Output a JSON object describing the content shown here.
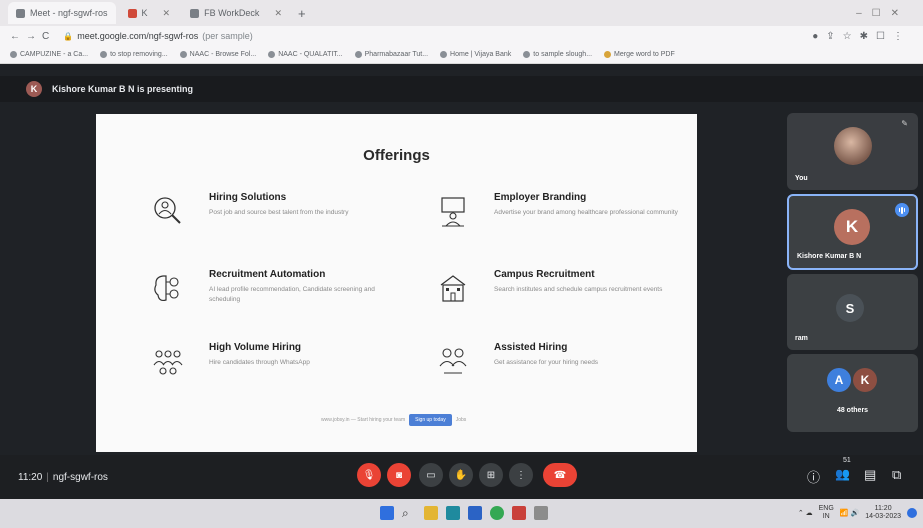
{
  "browser": {
    "tabs": [
      {
        "label": "Meet - ngf-sgwf-ros"
      },
      {
        "label": "K"
      },
      {
        "label": "FB WorkDeck"
      }
    ],
    "url": "meet.google.com/ngf-sgwf-ros",
    "url_suffix": "(per sample)",
    "bookmarks": [
      "CAMPUZINE - a Ca...",
      "to stop removing...",
      "NAAC - Browse Fol...",
      "NAAC - QUALATIT...",
      "Pharmabazaar Tut...",
      "Home | Vijaya Bank",
      "to sample slough...",
      "Merge word to PDF"
    ]
  },
  "banner": {
    "avatar_letter": "K",
    "text": "Kishore Kumar B N is presenting"
  },
  "slide": {
    "title": "Offerings",
    "offerings": [
      {
        "title": "Hiring Solutions",
        "desc": "Post job and source best talent from the industry",
        "icon": "magnifier-person-icon"
      },
      {
        "title": "Employer Branding",
        "desc": "Advertise your brand among healthcare professional community",
        "icon": "presenter-icon"
      },
      {
        "title": "Recruitment Automation",
        "desc": "AI lead profile recommendation, Candidate screening and scheduling",
        "icon": "brain-gear-icon"
      },
      {
        "title": "Campus Recruitment",
        "desc": "Search institutes and schedule campus recruitment events",
        "icon": "campus-building-icon"
      },
      {
        "title": "High Volume Hiring",
        "desc": "Hire candidates through WhatsApp",
        "icon": "group-people-icon"
      },
      {
        "title": "Assisted Hiring",
        "desc": "Get assistance for your hiring needs",
        "icon": "two-people-icon"
      }
    ],
    "footer_text": "www.jobsy.in — Start hiring your team",
    "footer_button": "Sign up today",
    "footer_right": "Jobs"
  },
  "participants": [
    {
      "name": "You",
      "type": "photo"
    },
    {
      "name": "Kishore Kumar B N",
      "letter": "K",
      "color": "#b8705f",
      "speaking": true
    },
    {
      "name": "ram",
      "letter": "S",
      "color": "#4a5157"
    },
    {
      "name": "48 others",
      "letters": [
        "A",
        "K"
      ],
      "colors": [
        "#3e7fdd",
        "#8d4f42"
      ]
    }
  ],
  "bottombar": {
    "time": "11:20",
    "code": "ngf-sgwf-ros",
    "participant_count": "51"
  },
  "taskbar": {
    "lang": "ENG",
    "region": "IN",
    "time": "11:20",
    "date": "14-03-2023"
  },
  "colors": {
    "accent": "#8ab4f8",
    "danger": "#ea4335",
    "meet_bg": "#1f2226",
    "tile": "#3c4043"
  }
}
